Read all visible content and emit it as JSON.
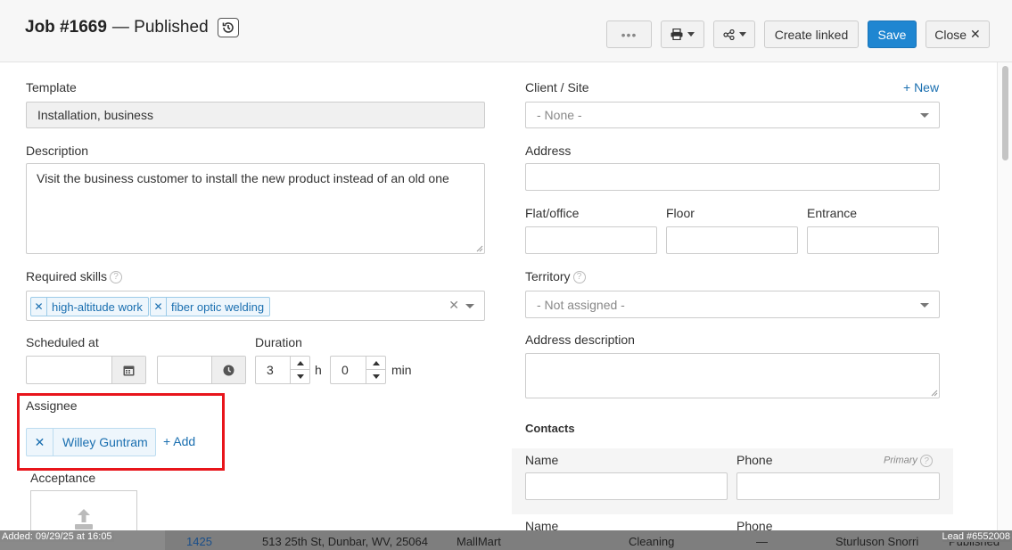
{
  "header": {
    "job_number": "Job #1669",
    "status": "— Published",
    "buttons": {
      "more": "•••",
      "create_linked": "Create linked",
      "save": "Save",
      "close": "Close"
    }
  },
  "form": {
    "template": {
      "label": "Template",
      "value": "Installation, business"
    },
    "description": {
      "label": "Description",
      "value": "Visit the business customer to install the new product instead of an old one"
    },
    "required_skills": {
      "label": "Required skills",
      "tags": [
        "high-altitude work",
        "fiber optic welding"
      ]
    },
    "scheduled_at": {
      "label": "Scheduled at",
      "date": "",
      "time": ""
    },
    "duration": {
      "label": "Duration",
      "hours": "3",
      "hours_unit": "h",
      "minutes": "0",
      "minutes_unit": "min"
    },
    "assignee": {
      "label": "Assignee",
      "name": "Willey Guntram",
      "add_label": "+ Add"
    },
    "acceptance": {
      "label": "Acceptance"
    }
  },
  "location": {
    "client_site": {
      "label": "Client / Site",
      "value": "- None -",
      "new_label": "+ New"
    },
    "address": {
      "label": "Address",
      "value": ""
    },
    "flat": {
      "label": "Flat/office",
      "value": ""
    },
    "floor": {
      "label": "Floor",
      "value": ""
    },
    "entrance": {
      "label": "Entrance",
      "value": ""
    },
    "territory": {
      "label": "Territory",
      "value": "- Not assigned -"
    },
    "address_description": {
      "label": "Address description",
      "value": ""
    }
  },
  "contacts": {
    "title": "Contacts",
    "name_label": "Name",
    "phone_label": "Phone",
    "primary_label": "Primary",
    "name2_label": "Name",
    "phone2_label": "Phone"
  },
  "background_row": {
    "added": "Added: 09/29/25 at 16:05",
    "id": "1425",
    "address": "513 25th St, Dunbar, WV, 25064",
    "client": "MallMart",
    "type": "Cleaning",
    "dash": "—",
    "person": "Sturluson Snorri",
    "status": "Published",
    "lead": "Lead #6552008"
  },
  "colors": {
    "primary_button": "#1f86d1",
    "highlight": "#e8151b",
    "tag_text": "#1a6fb0",
    "add_plus": "#5cb85c"
  }
}
